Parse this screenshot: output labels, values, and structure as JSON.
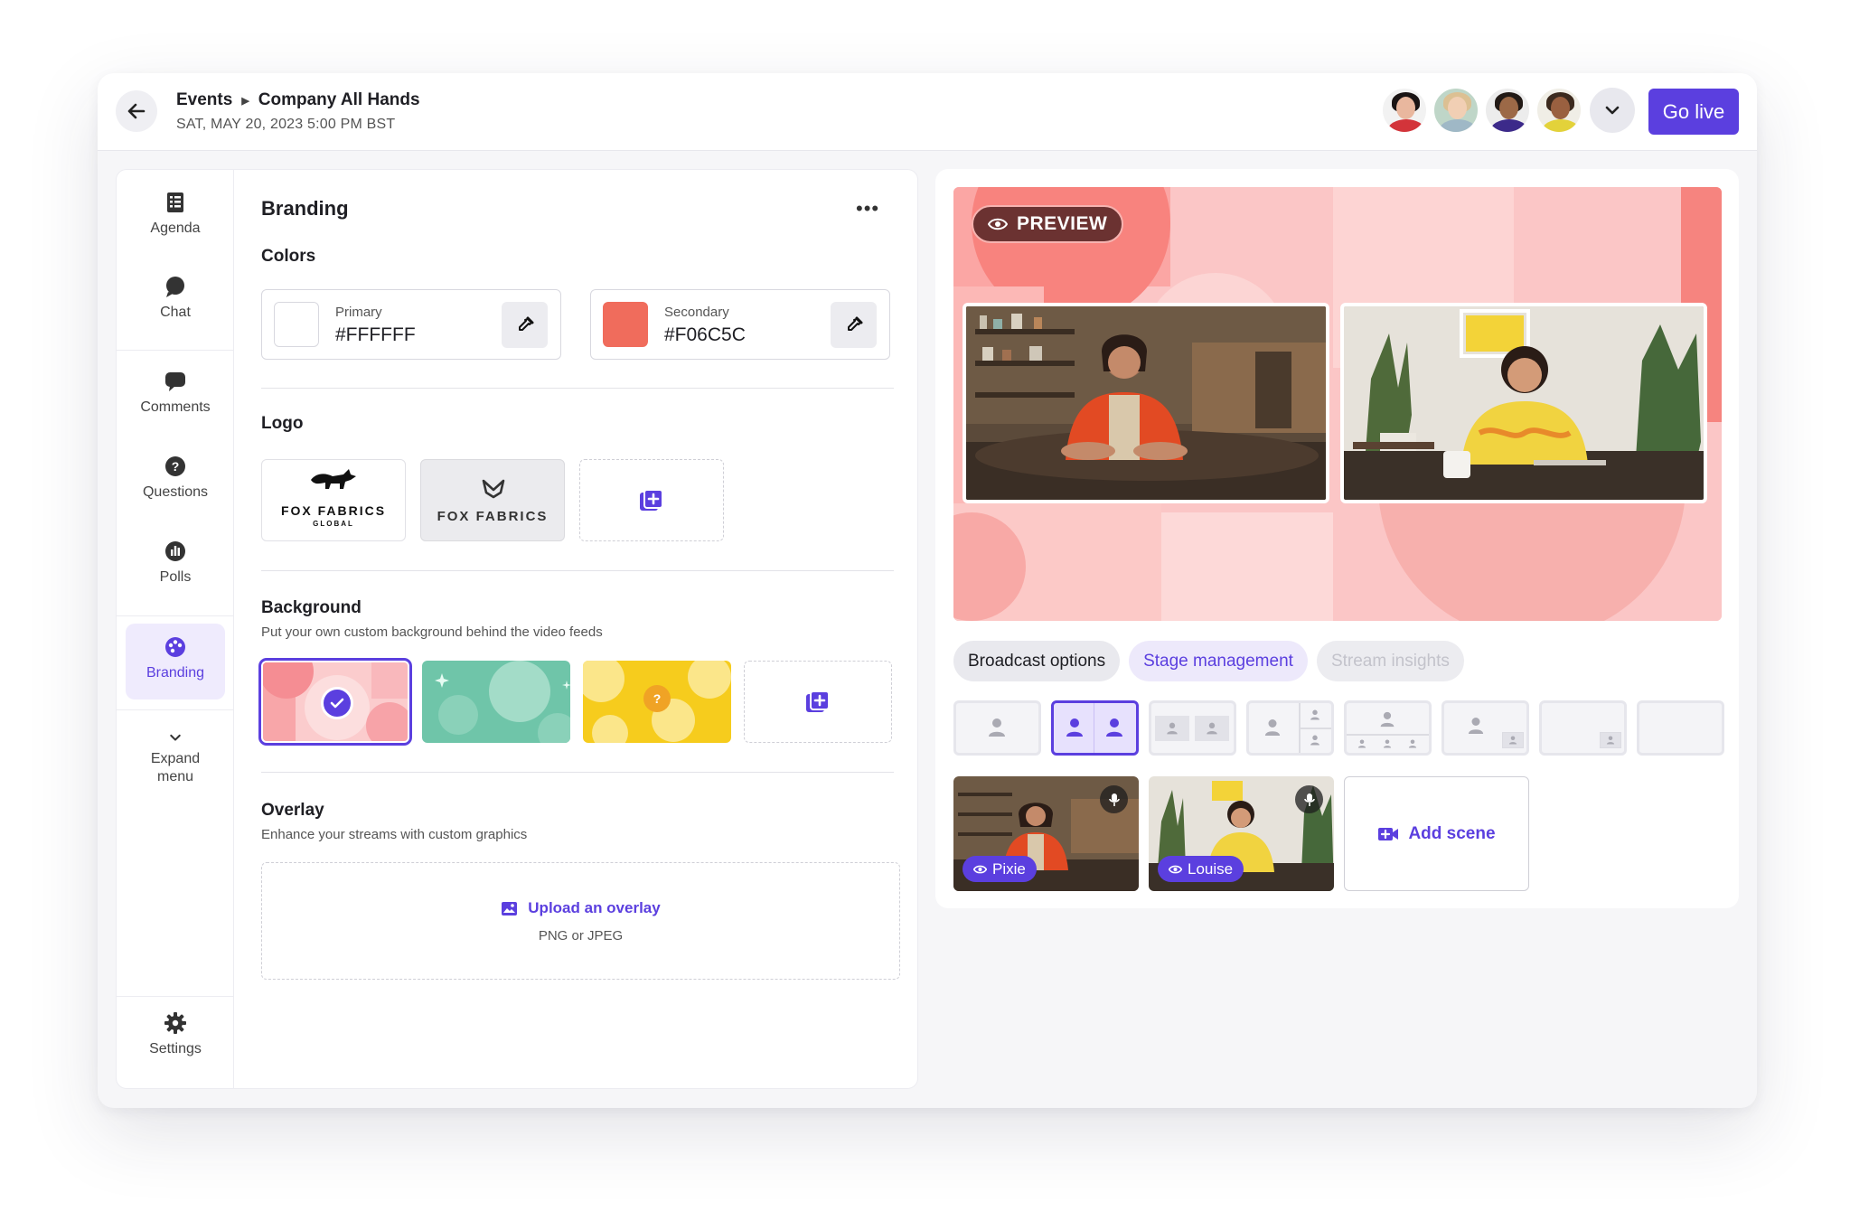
{
  "header": {
    "breadcrumb_root": "Events",
    "breadcrumb_current": "Company All Hands",
    "date": "SAT, MAY 20, 2023 5:00 PM BST",
    "go_live_label": "Go live"
  },
  "sidebar": {
    "items": [
      {
        "label": "Agenda",
        "icon": "agenda-icon"
      },
      {
        "label": "Chat",
        "icon": "chat-icon"
      },
      {
        "label": "Comments",
        "icon": "comments-icon"
      },
      {
        "label": "Questions",
        "icon": "question-icon"
      },
      {
        "label": "Polls",
        "icon": "polls-icon"
      },
      {
        "label": "Branding",
        "icon": "palette-icon",
        "active": true
      },
      {
        "label": "Expand\nmenu",
        "icon": "chevron-down-icon"
      }
    ],
    "settings_label": "Settings"
  },
  "branding": {
    "title": "Branding",
    "colors_heading": "Colors",
    "primary_label": "Primary",
    "primary_value": "#FFFFFF",
    "secondary_label": "Secondary",
    "secondary_value": "#F06C5C",
    "logo_heading": "Logo",
    "logo1_line1": "FOX FABRICS",
    "logo1_line2": "GLOBAL",
    "logo2_text": "FOX FABRICS",
    "background_heading": "Background",
    "background_sub": "Put your own custom background behind the video feeds",
    "overlay_heading": "Overlay",
    "overlay_sub": "Enhance your streams with custom graphics",
    "upload_label": "Upload an overlay",
    "upload_formats": "PNG or JPEG"
  },
  "stage": {
    "preview_label": "PREVIEW"
  },
  "tabs": [
    {
      "label": "Broadcast options",
      "state": "active"
    },
    {
      "label": "Stage management",
      "state": "accent"
    },
    {
      "label": "Stream insights",
      "state": "disabled"
    }
  ],
  "scenes": [
    {
      "name": "Pixie"
    },
    {
      "name": "Louise"
    }
  ],
  "add_scene_label": "Add scene",
  "colors": {
    "accent": "#5b3fdf",
    "secondary_swatch": "#F06C5C"
  }
}
